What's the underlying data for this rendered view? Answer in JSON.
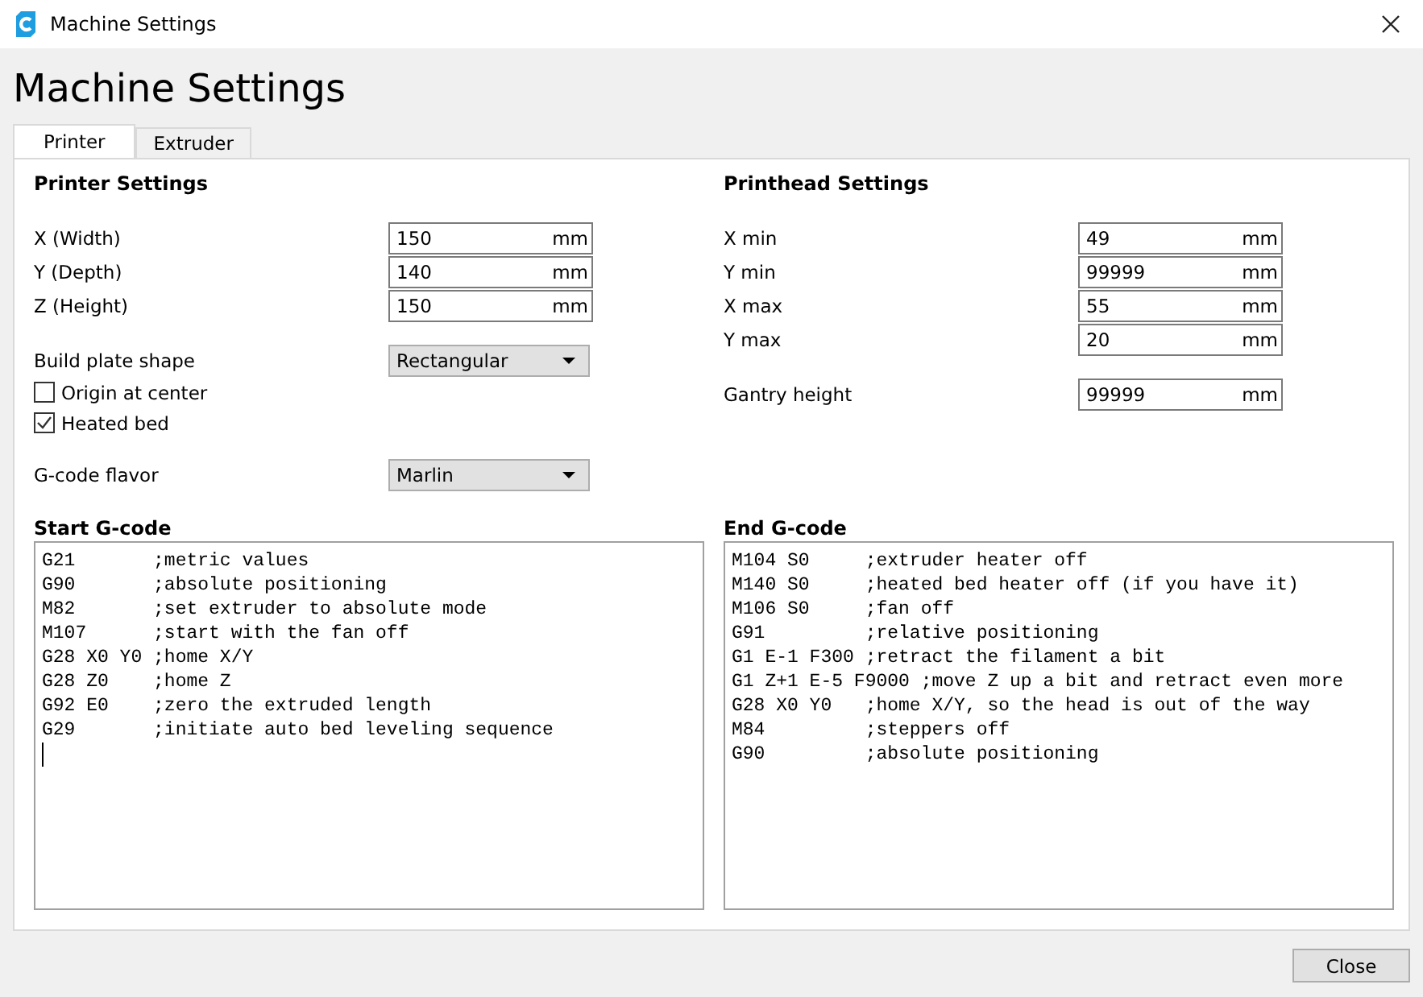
{
  "window": {
    "title": "Machine Settings"
  },
  "heading": "Machine Settings",
  "tabs": [
    {
      "label": "Printer",
      "selected": true
    },
    {
      "label": "Extruder",
      "selected": false
    }
  ],
  "printer_settings": {
    "title": "Printer Settings",
    "fields": [
      {
        "label": "X (Width)",
        "value": "150",
        "unit": "mm"
      },
      {
        "label": "Y (Depth)",
        "value": "140",
        "unit": "mm"
      },
      {
        "label": "Z (Height)",
        "value": "150",
        "unit": "mm"
      }
    ],
    "build_plate": {
      "label": "Build plate shape",
      "value": "Rectangular"
    },
    "checkboxes": [
      {
        "label": "Origin at center",
        "checked": false
      },
      {
        "label": "Heated bed",
        "checked": true
      }
    ],
    "gcode_flavor": {
      "label": "G-code flavor",
      "value": "Marlin"
    }
  },
  "printhead_settings": {
    "title": "Printhead Settings",
    "fields": [
      {
        "label": "X min",
        "value": "49",
        "unit": "mm"
      },
      {
        "label": "Y min",
        "value": "99999",
        "unit": "mm"
      },
      {
        "label": "X max",
        "value": "55",
        "unit": "mm"
      },
      {
        "label": "Y max",
        "value": "20",
        "unit": "mm"
      }
    ],
    "gantry": {
      "label": "Gantry height",
      "value": "99999",
      "unit": "mm"
    }
  },
  "start_gcode": {
    "title": "Start G-code",
    "lines": [
      "G21       ;metric values",
      "G90       ;absolute positioning",
      "M82       ;set extruder to absolute mode",
      "M107      ;start with the fan off",
      "G28 X0 Y0 ;home X/Y",
      "G28 Z0    ;home Z",
      "G92 E0    ;zero the extruded length",
      "G29       ;initiate auto bed leveling sequence"
    ]
  },
  "end_gcode": {
    "title": "End G-code",
    "lines": [
      "M104 S0     ;extruder heater off",
      "M140 S0     ;heated bed heater off (if you have it)",
      "M106 S0     ;fan off",
      "G91         ;relative positioning",
      "G1 E-1 F300 ;retract the filament a bit",
      "G1 Z+1 E-5 F9000 ;move Z up a bit and retract even more",
      "G28 X0 Y0   ;home X/Y, so the head is out of the way",
      "M84         ;steppers off",
      "G90         ;absolute positioning"
    ]
  },
  "buttons": [
    "Close"
  ]
}
